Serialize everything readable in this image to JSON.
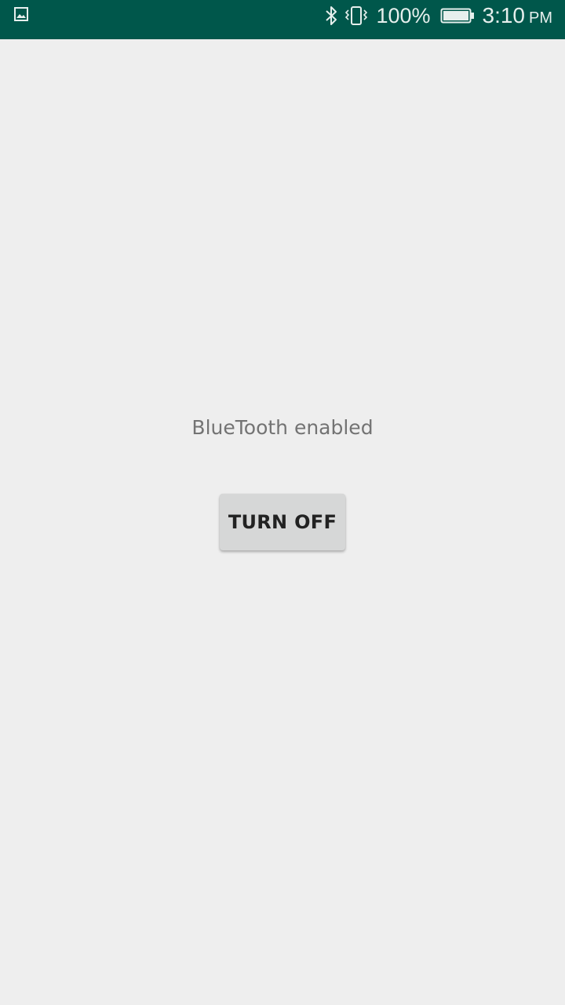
{
  "status_bar": {
    "notification_icon": "image-icon",
    "bluetooth_icon": "bluetooth-icon",
    "vibrate_icon": "vibrate-icon",
    "battery_percent": "100%",
    "battery_icon": "battery-full-icon",
    "time": "3:10",
    "ampm": "PM",
    "background_color": "#00574b"
  },
  "main": {
    "status_message": "BlueTooth enabled",
    "toggle_button_label": "TURN OFF"
  }
}
